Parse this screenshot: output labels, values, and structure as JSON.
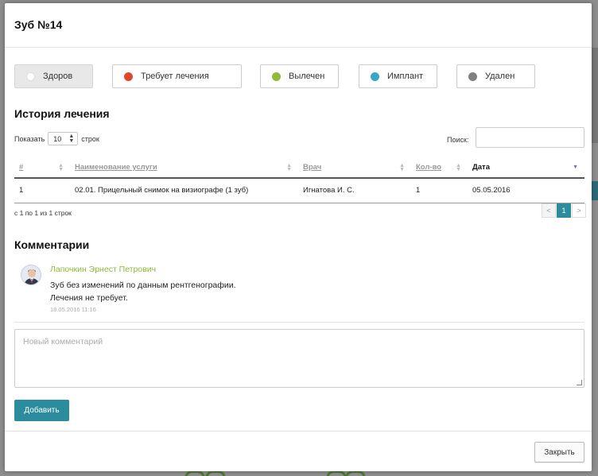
{
  "modal": {
    "title": "Зуб №14"
  },
  "statuses": [
    {
      "label": "Здоров",
      "color": "#ffffff",
      "active": true
    },
    {
      "label": "Требует лечения",
      "color": "#e0472a",
      "active": false
    },
    {
      "label": "Вылечен",
      "color": "#8dbb3a",
      "active": false
    },
    {
      "label": "Имплант",
      "color": "#35a8c8",
      "active": false
    },
    {
      "label": "Удален",
      "color": "#808080",
      "active": false
    }
  ],
  "history": {
    "title": "История лечения",
    "show_label": "Показать",
    "length_value": "10",
    "rows_label": "строк",
    "search_label": "Поиск:",
    "search_value": "",
    "columns": [
      "#",
      "Наименование услуги",
      "Врач",
      "Кол-во",
      "Дата"
    ],
    "rows": [
      [
        "1",
        "02.01. Прицельный снимок на визиографе (1 зуб)",
        "Игнатова И. С.",
        "1",
        "05.05.2016"
      ]
    ],
    "info": "с 1 по 1 из 1 строк",
    "pagination": {
      "prev": "<",
      "current": "1",
      "next": ">"
    }
  },
  "comments": {
    "title": "Комментарии",
    "items": [
      {
        "author": "Лапочкин Эрнест Петрович",
        "text_line1": "Зуб без изменений по данным рентгенографии.",
        "text_line2": "Лечения не требует.",
        "date": "18.05.2016 11:16"
      }
    ],
    "new_placeholder": "Новый комментарий",
    "add_label": "Добавить"
  },
  "footer": {
    "close_label": "Закрыть"
  },
  "colors": {
    "accent": "#2a8c9c",
    "author": "#8bbb3a"
  }
}
